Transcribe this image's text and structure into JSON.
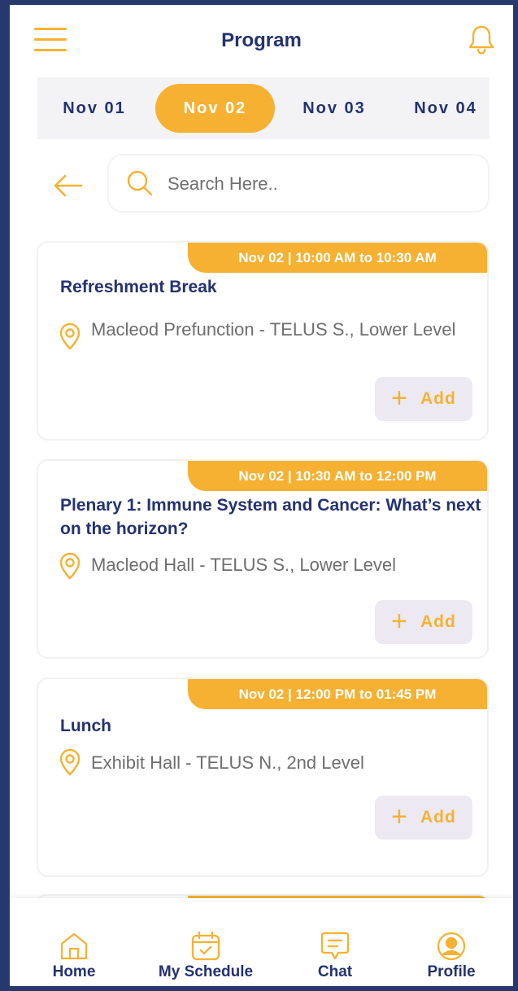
{
  "header": {
    "title": "Program",
    "menu_icon": "hamburger-menu-icon",
    "bell_icon": "bell-icon"
  },
  "date_tabs": [
    {
      "label": "Nov 01",
      "active": false
    },
    {
      "label": "Nov 02",
      "active": true
    },
    {
      "label": "Nov 03",
      "active": false
    },
    {
      "label": "Nov 04",
      "active": false
    }
  ],
  "search": {
    "placeholder": "Search Here..",
    "value": ""
  },
  "sessions": [
    {
      "time": "Nov 02 | 10:00 AM to 10:30 AM",
      "title": "Refreshment Break",
      "location": "Macleod Prefunction - TELUS S., Lower Level",
      "add_label": "Add"
    },
    {
      "time": "Nov 02 | 10:30 AM to 12:00 PM",
      "title": "Plenary 1: Immune System and Cancer: What’s next on the horizon?",
      "location": "Macleod Hall - TELUS S., Lower Level",
      "add_label": "Add"
    },
    {
      "time": "Nov 02 | 12:00 PM to 01:45 PM",
      "title": "Lunch",
      "location": "Exhibit Hall - TELUS N., 2nd Level",
      "add_label": "Add"
    }
  ],
  "bottom_nav": [
    {
      "label": "Home",
      "icon": "home-icon"
    },
    {
      "label": "My Schedule",
      "icon": "calendar-check-icon"
    },
    {
      "label": "Chat",
      "icon": "chat-bubble-icon"
    },
    {
      "label": "Profile",
      "icon": "user-circle-icon"
    }
  ],
  "colors": {
    "accent": "#f6b132",
    "primary_text": "#243271",
    "frame_border": "#27386f",
    "add_button_bg": "#ece9f2"
  }
}
